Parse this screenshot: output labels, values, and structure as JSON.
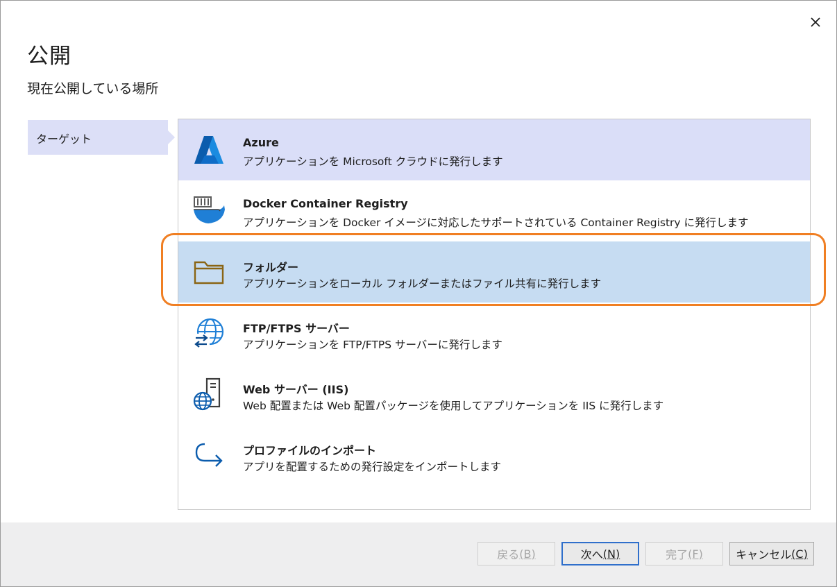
{
  "dialog": {
    "title": "公開",
    "subtitle": "現在公開している場所",
    "close_icon": "close-icon"
  },
  "nav": {
    "items": [
      {
        "label": "ターゲット",
        "selected": true
      }
    ]
  },
  "targets": [
    {
      "icon": "azure-logo-icon",
      "name": "Azure",
      "description": "アプリケーションを Microsoft クラウドに発行します",
      "state": "hover"
    },
    {
      "icon": "docker-container-icon",
      "name": "Docker Container Registry",
      "description": "アプリケーションを Docker イメージに対応したサポートされている Container Registry に発行します",
      "state": "normal"
    },
    {
      "icon": "folder-icon",
      "name": "フォルダー",
      "description": "アプリケーションをローカル フォルダーまたはファイル共有に発行します",
      "state": "selected"
    },
    {
      "icon": "globe-transfer-icon",
      "name": "FTP/FTPS サーバー",
      "description": "アプリケーションを FTP/FTPS サーバーに発行します",
      "state": "normal"
    },
    {
      "icon": "web-server-globe-icon",
      "name": "Web サーバー (IIS)",
      "description": "Web 配置または Web 配置パッケージを使用してアプリケーションを IIS に発行します",
      "state": "normal"
    },
    {
      "icon": "import-arrow-icon",
      "name": "プロファイルのインポート",
      "description": "アプリを配置するための発行設定をインポートします",
      "state": "normal"
    }
  ],
  "buttons": {
    "back": {
      "label": "戻る",
      "mnemonic": "(B)",
      "enabled": false
    },
    "next": {
      "label": "次へ",
      "mnemonic": "(N)",
      "enabled": true
    },
    "finish": {
      "label": "完了",
      "mnemonic": "(F)",
      "enabled": false
    },
    "cancel": {
      "label": "キャンセル",
      "mnemonic": "(C)",
      "enabled": true
    }
  },
  "colors": {
    "accent_highlight": "#f07f23",
    "selected_row": "#c6dcf2",
    "hover_row": "#dadef8",
    "primary_button_border": "#2f6fcb"
  }
}
